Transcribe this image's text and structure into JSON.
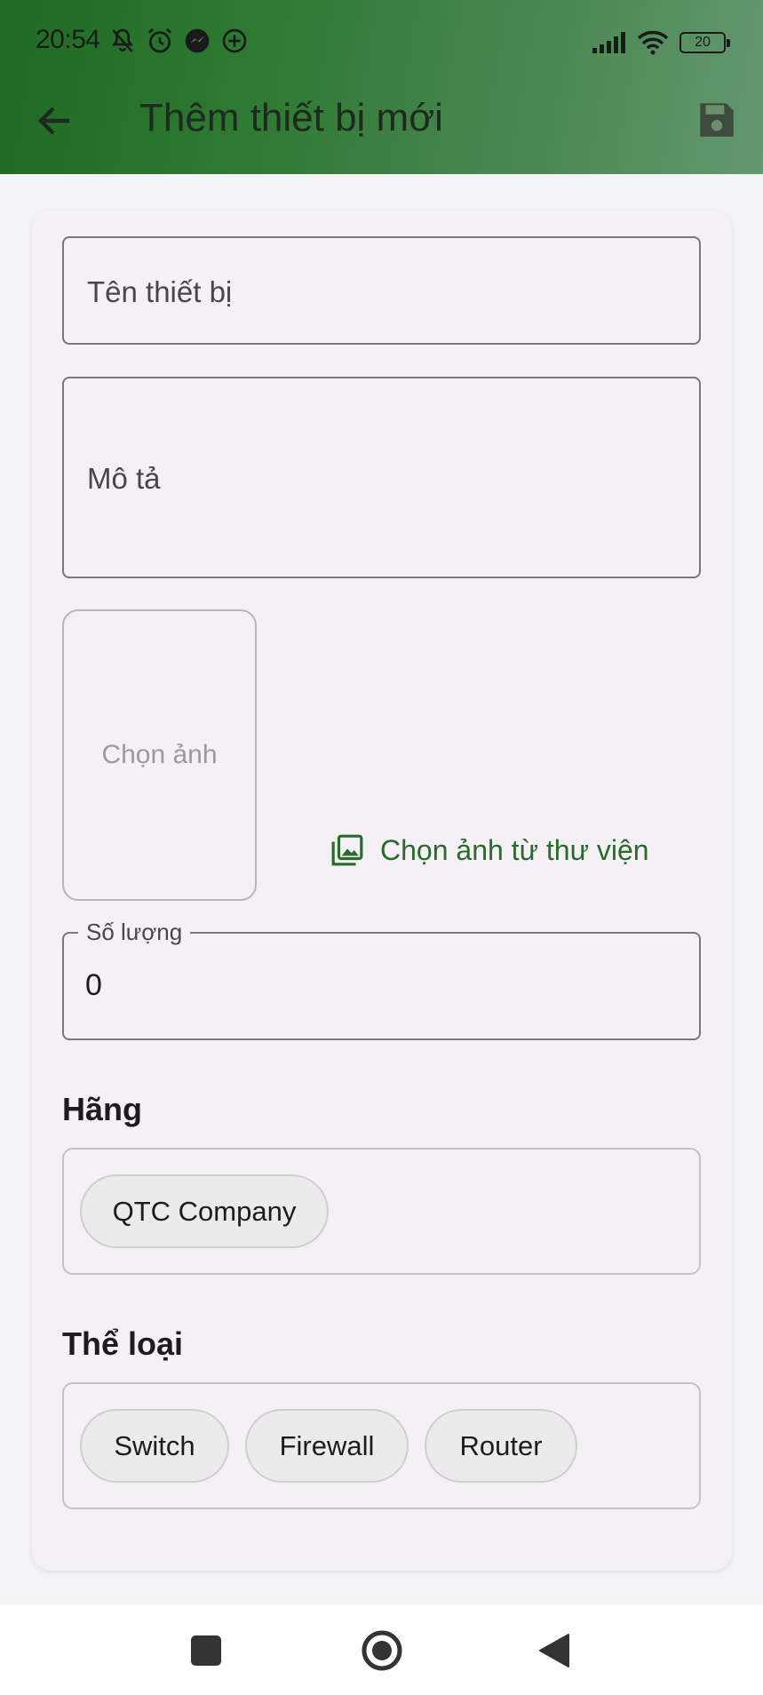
{
  "status_bar": {
    "time": "20:54",
    "icons_left": [
      "bell-off-icon",
      "alarm-icon",
      "messenger-icon",
      "plus-circle-icon"
    ],
    "icons_right": [
      "signal-icon",
      "wifi-icon",
      "battery-icon"
    ],
    "battery_level": "20"
  },
  "app_bar": {
    "title": "Thêm thiết bị mới",
    "back_icon": "arrow-back-icon",
    "save_icon": "save-icon",
    "gradient": [
      "#1f6a22",
      "#649870"
    ]
  },
  "form": {
    "name_label": "Tên thiết bị",
    "description_label": "Mô tả",
    "image_placeholder": "Chọn ảnh",
    "gallery_button": "Chọn ảnh từ thư viện",
    "quantity_label": "Số lượng",
    "quantity_value": "0"
  },
  "brand": {
    "title": "Hãng",
    "chips": [
      "QTC Company"
    ]
  },
  "category": {
    "title": "Thể loại",
    "chips": [
      "Switch",
      "Firewall",
      "Router"
    ]
  },
  "colors": {
    "accent_green": "#2a6a2c",
    "card_bg": "#f5f0f6"
  },
  "nav_bar": {
    "icons": [
      "recent-apps-icon",
      "home-icon",
      "back-triangle-icon"
    ]
  }
}
